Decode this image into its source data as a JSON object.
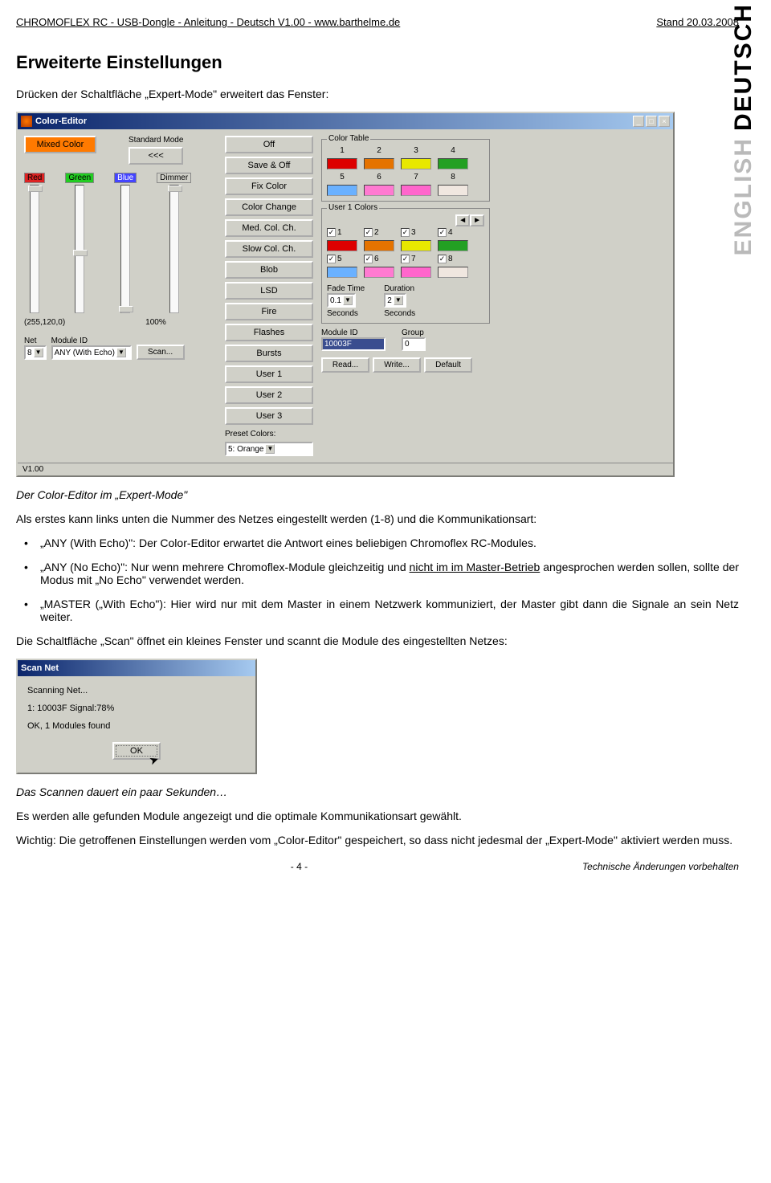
{
  "header": {
    "left": "CHROMOFLEX RC -  USB-Dongle - Anleitung - Deutsch V1.00 - www.barthelme.de",
    "right": "Stand 20.03.2008"
  },
  "langs": {
    "top": "DEUTSCH",
    "bottom": "ENGLISH"
  },
  "heading": "Erweiterte Einstellungen",
  "intro": "Drücken der Schaltfläche „Expert-Mode\" erweitert das Fenster:",
  "editor": {
    "title": "Color-Editor",
    "mixed": "Mixed Color",
    "stdmode": "Standard Mode",
    "stdbtn": "<<<",
    "sliders": {
      "red": "Red",
      "green": "Green",
      "blue": "Blue",
      "dimmer": "Dimmer"
    },
    "rgb": "(255,120,0)",
    "dimval": "100%",
    "net": "Net",
    "netval": "8",
    "modid": "Module ID",
    "modval": "ANY (With Echo)",
    "scan": "Scan...",
    "progbtns": [
      "Off",
      "Save & Off",
      "Fix Color",
      "Color Change",
      "Med. Col. Ch.",
      "Slow Col. Ch.",
      "Blob",
      "LSD",
      "Fire",
      "Flashes",
      "Bursts",
      "User 1",
      "User 2",
      "User 3"
    ],
    "preset_lbl": "Preset Colors:",
    "preset_val": "5: Orange",
    "ctable_title": "Color Table",
    "nums": [
      "1",
      "2",
      "3",
      "4",
      "5",
      "6",
      "7",
      "8"
    ],
    "ctable_colors": [
      "#d00",
      "#e57300",
      "#e8e800",
      "#23a023",
      "#6ab1ff",
      "#ff7ad1",
      "#ff66cc",
      "#f0e7e0"
    ],
    "u1title": "User 1 Colors",
    "u1colors": [
      "#d00",
      "#e57300",
      "#e8e800",
      "#23a023",
      "#6ab1ff",
      "#ff7ad1",
      "#ff66cc",
      "#f0e7e0"
    ],
    "fade": "Fade Time",
    "fadeval": "0.1",
    "dur": "Duration",
    "durval": "2",
    "sec": "Seconds",
    "rmodid": "Module ID",
    "rmodval": "10003F",
    "grp": "Group",
    "grpval": "0",
    "read": "Read...",
    "write": "Write...",
    "default": "Default",
    "status": "V1.00"
  },
  "caption1": "Der Color-Editor im „Expert-Mode\"",
  "para1": "Als erstes kann links unten die Nummer des Netzes eingestellt werden (1-8) und die Kommunikationsart:",
  "bullets": [
    {
      "text": "„ANY (With Echo)\": Der Color-Editor erwartet die Antwort eines beliebigen Chromoflex RC-Modules."
    },
    {
      "pre": "„ANY (No Echo)\": Nur wenn mehrere Chromoflex-Module gleichzeitig und ",
      "u": "nicht im im Master-Betrieb",
      "post": " angesprochen werden sollen, sollte der Modus mit „No Echo\" verwendet werden."
    },
    {
      "text": "„MASTER („With Echo\"): Hier wird nur mit dem Master in einem Netzwerk kommuniziert, der Master gibt dann die Signale an sein Netz weiter."
    }
  ],
  "para2": "Die Schaltfläche „Scan\" öffnet ein kleines Fenster und scannt die Module des eingestellten Netzes:",
  "scan": {
    "title": "Scan Net",
    "l1": "Scanning Net...",
    "l2": "1: 10003F  Signal:78%",
    "l3": "OK, 1 Modules found",
    "ok": "OK"
  },
  "caption2": "Das Scannen dauert ein paar Sekunden…",
  "para3": "Es werden alle gefunden Module angezeigt und die optimale Kommunikationsart gewählt.",
  "para4": "Wichtig: Die getroffenen Einstellungen werden vom „Color-Editor\" gespeichert, so dass nicht jedesmal der „Expert-Mode\" aktiviert werden muss.",
  "footer": {
    "page": "- 4 -",
    "note": "Technische Änderungen vorbehalten"
  }
}
